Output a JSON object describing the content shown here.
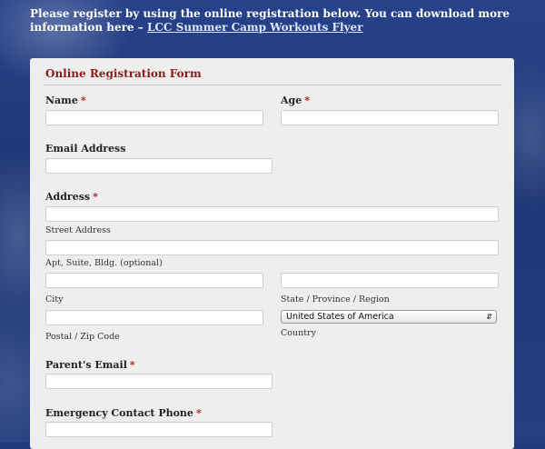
{
  "intro": {
    "text": "Please register by using the online registration below. You can download more information here –",
    "link": "LCC Summer Camp Workouts Flyer"
  },
  "form": {
    "title": "Online Registration Form",
    "required_mark": "*",
    "name_label": "Name",
    "age_label": "Age",
    "email_label": "Email Address",
    "address_label": "Address",
    "street_label": "Street Address",
    "apt_label": "Apt, Suite, Bldg. (optional)",
    "city_label": "City",
    "state_label": "State / Province / Region",
    "zip_label": "Postal / Zip Code",
    "country_label": "Country",
    "country_value": "United States of America",
    "parent_email_label": "Parent's Email",
    "emergency_label": "Emergency Contact Phone"
  },
  "icons": {
    "select_arrow": "up-down-chevron-icon"
  }
}
